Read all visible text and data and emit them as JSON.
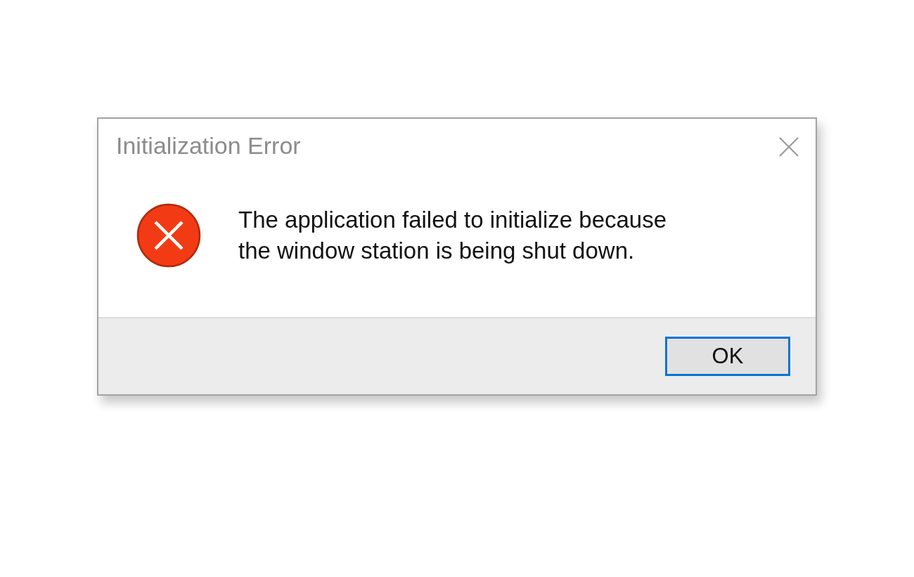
{
  "window": {
    "title": "Initialization Error"
  },
  "message": {
    "kind": "error",
    "text": "The application failed to initialize because the window station is being shut down."
  },
  "buttons": [
    {
      "label": "OK",
      "focused": true
    }
  ]
}
